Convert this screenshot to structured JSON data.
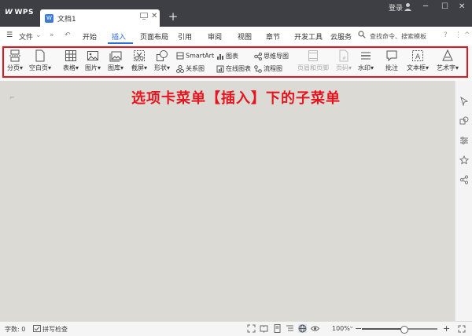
{
  "titlebar": {
    "app_name": "WPS",
    "doc_tab_title": "文档1",
    "doc_icon_letter": "W",
    "new_tab": "+",
    "login": "登录",
    "doc_monitor_icon": "monitor-icon",
    "doc_close": "✕"
  },
  "menubar": {
    "hamburger": "☰",
    "file": "文件",
    "file_arrow": "⌄",
    "more_left": "»",
    "undo": "↶",
    "tabs": [
      "开始",
      "插入",
      "页面布局",
      "引用",
      "审阅",
      "视图",
      "章节",
      "开发工具",
      "云服务"
    ],
    "active_tab": "插入",
    "search_placeholder": "查找命令、搜索模板",
    "help": "?",
    "more_right": "⋮",
    "collapse": "^"
  },
  "ribbon": {
    "big_buttons": [
      {
        "id": "page-break",
        "label": "分页",
        "icon": "page-break-icon",
        "enabled": true
      },
      {
        "id": "blank-page",
        "label": "空白页",
        "icon": "blank-page-icon",
        "enabled": true
      },
      {
        "id": "table",
        "label": "表格",
        "icon": "table-icon",
        "enabled": true
      },
      {
        "id": "picture",
        "label": "图片",
        "icon": "picture-icon",
        "enabled": true
      },
      {
        "id": "gallery",
        "label": "图库",
        "icon": "gallery-icon",
        "enabled": true
      },
      {
        "id": "screenshot",
        "label": "截屏",
        "icon": "scissors-icon",
        "enabled": true
      },
      {
        "id": "shape",
        "label": "形状",
        "icon": "shape-icon",
        "enabled": true
      },
      {
        "id": "header-footer",
        "label": "页眉和页脚",
        "icon": "header-footer-icon",
        "enabled": false
      },
      {
        "id": "page-number",
        "label": "页码",
        "icon": "page-number-icon",
        "enabled": false
      },
      {
        "id": "watermark",
        "label": "水印",
        "icon": "watermark-icon",
        "enabled": true
      },
      {
        "id": "comment",
        "label": "批注",
        "icon": "comment-icon",
        "enabled": true
      },
      {
        "id": "textbox",
        "label": "文本框",
        "icon": "textbox-icon",
        "enabled": true
      },
      {
        "id": "wordart",
        "label": "艺术字",
        "icon": "wordart-icon",
        "enabled": true
      }
    ],
    "small_buttons": [
      {
        "id": "smartart",
        "label": "SmartArt",
        "icon": "smartart-icon"
      },
      {
        "id": "relation-chart",
        "label": "关系图",
        "icon": "relation-icon"
      },
      {
        "id": "chart",
        "label": "图表",
        "icon": "chart-icon"
      },
      {
        "id": "online-chart",
        "label": "在线图表",
        "icon": "online-chart-icon"
      },
      {
        "id": "mind-map",
        "label": "思维导图",
        "icon": "mindmap-icon"
      },
      {
        "id": "flowchart",
        "label": "流程图",
        "icon": "flowchart-icon"
      }
    ]
  },
  "annotation": "选项卡菜单【插入】下的子菜单",
  "statusbar": {
    "word_count": "字数: 0",
    "spell_check": "拼写检查",
    "zoom": "100%",
    "zoom_level": 0.55,
    "zoom_minus": "−",
    "zoom_plus": "+"
  },
  "colors": {
    "accent": "#2a6fd6",
    "highlight": "#e5141d",
    "titlebar": "#3d3f45"
  }
}
